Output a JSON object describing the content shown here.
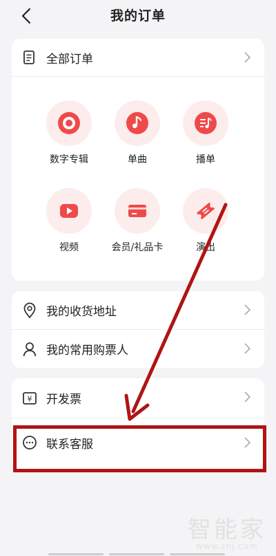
{
  "header": {
    "title": "我的订单"
  },
  "orders": {
    "all_label": "全部订单",
    "categories": [
      {
        "label": "数字专辑",
        "icon": "vinyl-icon"
      },
      {
        "label": "单曲",
        "icon": "music-note-icon"
      },
      {
        "label": "播单",
        "icon": "playlist-icon"
      },
      {
        "label": "视频",
        "icon": "video-play-icon"
      },
      {
        "label": "会员/礼品卡",
        "icon": "card-icon"
      },
      {
        "label": "演出",
        "icon": "ticket-icon"
      }
    ]
  },
  "address_section": {
    "items": [
      {
        "label": "我的收货地址",
        "icon": "location-pin-icon"
      },
      {
        "label": "我的常用购票人",
        "icon": "person-icon"
      }
    ]
  },
  "service_section": {
    "items": [
      {
        "label": "开发票",
        "icon": "invoice-yen-icon"
      },
      {
        "label": "联系客服",
        "icon": "chat-bubble-icon"
      }
    ]
  },
  "watermark": {
    "main": "智能家",
    "sub": "www.znj.com"
  },
  "colors": {
    "accent": "#ef4a4a",
    "icon_bg": "#fdecec",
    "annotation": "#b01414"
  }
}
